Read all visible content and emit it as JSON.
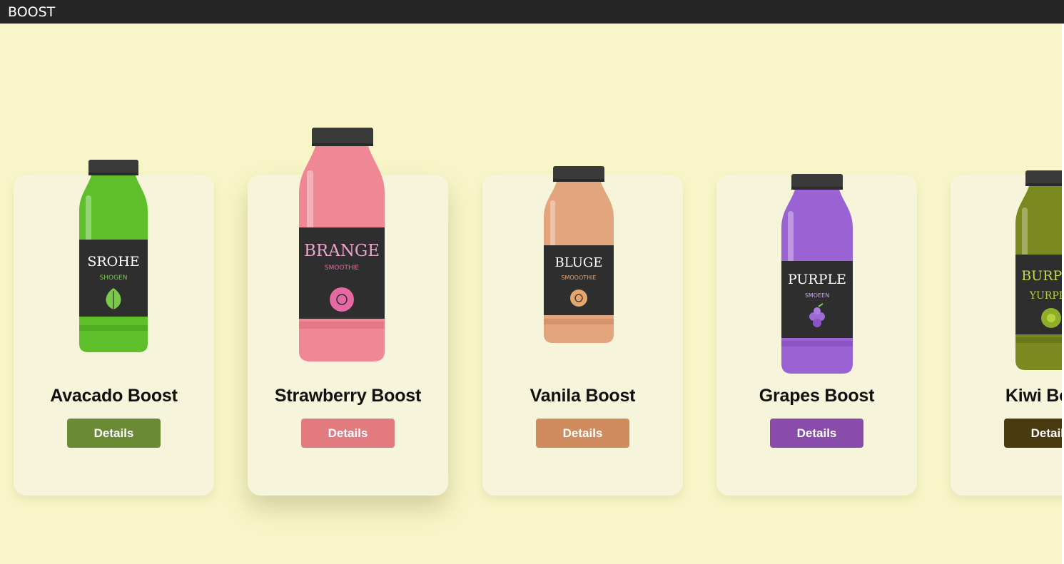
{
  "window": {
    "title": "BOOST"
  },
  "products": [
    {
      "name": "Avacado Boost",
      "button_label": "Details",
      "button_color": "#6b8a34",
      "bottle": {
        "liquid": "#5fbf2a",
        "liquid_dark": "#3f9a1c",
        "label_text": "SROHE",
        "sub_text": "SHOGEN",
        "accent": "#79c94a",
        "icon": "leaf-icon"
      }
    },
    {
      "name": "Strawberry Boost",
      "button_label": "Details",
      "button_color": "#e27a80",
      "bottle": {
        "liquid": "#f08795",
        "liquid_dark": "#d96479",
        "label_text": "BRANGE",
        "sub_text": "SMOOTHIE",
        "accent": "#e56aa3",
        "icon": "circle-icon"
      }
    },
    {
      "name": "Vanila Boost",
      "button_label": "Details",
      "button_color": "#d08c5e",
      "bottle": {
        "liquid": "#e2a57d",
        "liquid_dark": "#c7845c",
        "label_text": "BLUGE",
        "sub_text": "SMOOOTHIE",
        "accent": "#e5a56f",
        "icon": "circle-icon"
      }
    },
    {
      "name": "Grapes Boost",
      "button_label": "Details",
      "button_color": "#8a4cab",
      "bottle": {
        "liquid": "#9a62d2",
        "liquid_dark": "#7a45b6",
        "label_text": "PURPLE",
        "sub_text": "SMOEEN",
        "accent": "#9f6ad6",
        "icon": "grape-icon"
      }
    },
    {
      "name": "Kiwi Boost",
      "button_label": "Details",
      "button_color": "#4a3a10",
      "bottle": {
        "liquid": "#7a8a20",
        "liquid_dark": "#5b6814",
        "label_text": "BURPLE",
        "sub_text": "YURPLE",
        "accent": "#b8d03a",
        "icon": "circle-icon"
      }
    }
  ]
}
